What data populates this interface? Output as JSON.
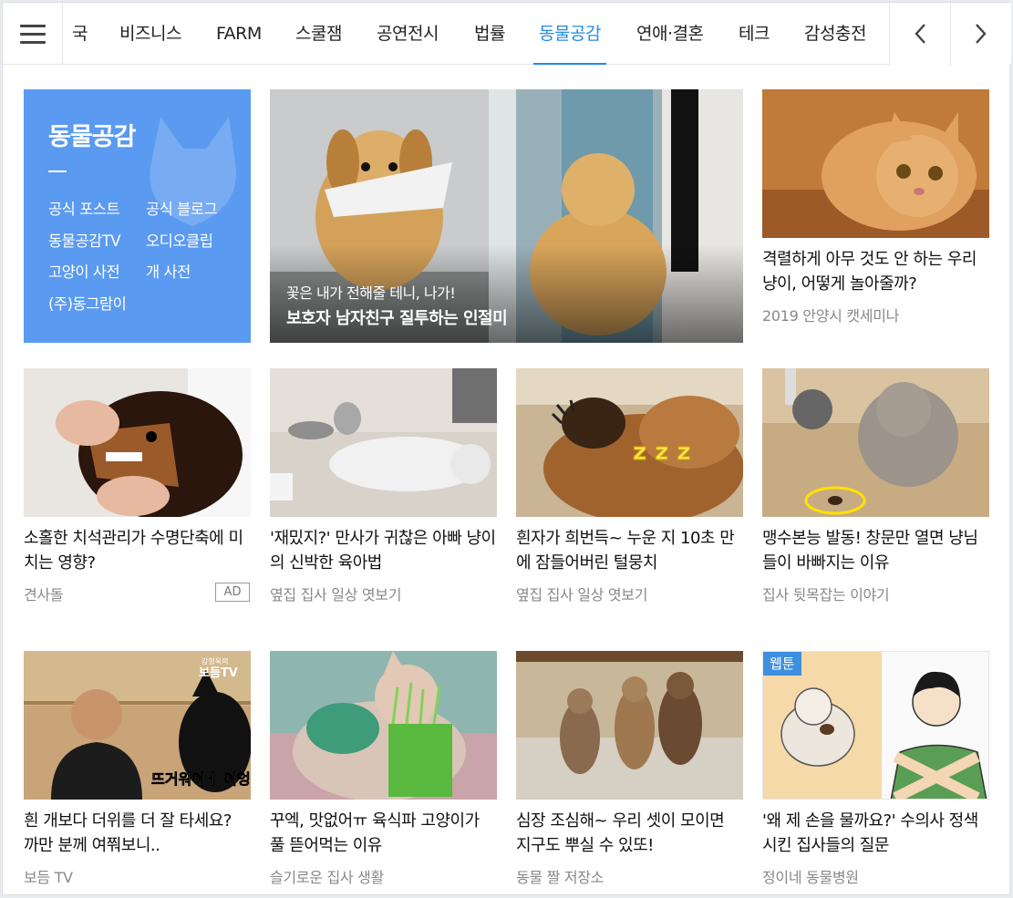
{
  "nav": {
    "menu_icon": "hamburger-icon",
    "tabs": [
      "국",
      "비즈니스",
      "FARM",
      "스쿨잼",
      "공연전시",
      "법률",
      "동물공감",
      "연애·결혼",
      "테크",
      "감성충전"
    ],
    "active_tab": "동물공감",
    "prev_icon": "chevron-left-icon",
    "next_icon": "chevron-right-icon",
    "accent_color": "#1f8ce6"
  },
  "intro": {
    "title": "동물공감",
    "links": [
      "공식 포스트",
      "공식 블로그",
      "동물공감TV",
      "오디오클립",
      "고양이 사전",
      "개 사전",
      "(주)동그람이"
    ],
    "bg_color": "#5a9af0"
  },
  "featured": {
    "subtitle": "꽃은 내가 전해줄 테니, 나가!",
    "title": "보호자 남자친구 질투하는 인절미"
  },
  "cards": [
    {
      "title": "격렬하게 아무 것도 안 하는 우리 냥이, 어떻게 놀아줄까?",
      "source": "2019 안양시 캣세미나"
    },
    {
      "title": "소홀한 치석관리가 수명단축에 미치는 영향?",
      "source": "견사돌",
      "ad": "AD"
    },
    {
      "title": "'재밌지?' 만사가 귀찮은 아빠 냥이의 신박한 육아법",
      "source": "옆집 집사 일상 엿보기"
    },
    {
      "title": "흰자가 희번득~ 누운 지 10초 만에 잠들어버린 털뭉치",
      "source": "옆집 집사 일상 엿보기"
    },
    {
      "title": "맹수본능 발동! 창문만 열면 냥님들이 바빠지는 이유",
      "source": "집사 뒷목잡는 이야기"
    },
    {
      "title": "흰 개보다 더위를 더 잘 타세요? 까만 분께 여쭤보니..",
      "source": "보듬 TV"
    },
    {
      "title": "꾸엑, 맛없어ㅠ 육식파 고양이가 풀 뜯어먹는 이유",
      "source": "슬기로운 집사 생활"
    },
    {
      "title": "심장 조심해~ 우리 셋이 모이면 지구도 뿌실 수 있또!",
      "source": "동물 짤 저장소"
    },
    {
      "title": "'왜 제 손을 물까요?' 수의사 정색시킨 집사들의 질문",
      "source": "정이네 동물병원",
      "badge": "웹툰"
    }
  ],
  "image_texts": {
    "zzz": "z z z",
    "tv_logo_small": "강형욱의",
    "tv_logo": "보듬TV",
    "tv_caption": "뜨거워어ㅓ 어엉!!"
  }
}
